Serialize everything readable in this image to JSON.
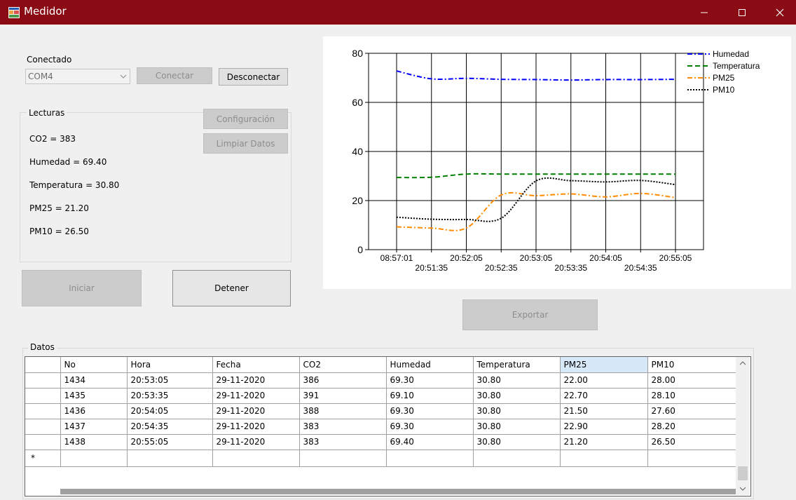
{
  "window": {
    "title": "Medidor",
    "controls": [
      "minimize",
      "maximize",
      "close"
    ]
  },
  "connection": {
    "status_label": "Conectado",
    "port_value": "COM4",
    "connect_label": "Conectar",
    "disconnect_label": "Desconectar"
  },
  "readings": {
    "group_label": "Lecturas",
    "config_label": "Configuración",
    "clear_label": "Limpiar Datos",
    "co2": "CO2 = 383",
    "humidity": "Humedad = 69.40",
    "temperature": "Temperatura = 30.80",
    "pm25": "PM25 = 21.20",
    "pm10": "PM10 = 26.50"
  },
  "actions": {
    "start_label": "Iniciar",
    "stop_label": "Detener",
    "export_label": "Exportar"
  },
  "chart_data": {
    "type": "line",
    "title": "",
    "xlabel": "",
    "ylabel": "",
    "ylim": [
      0,
      80
    ],
    "yticks": [
      0,
      20,
      40,
      60,
      80
    ],
    "grid": true,
    "legend_position": "top-right",
    "categories": [
      "08:57:01",
      "20:51:35",
      "20:52:05",
      "20:52:35",
      "20:53:05",
      "20:53:35",
      "20:54:05",
      "20:54:35",
      "20:55:05"
    ],
    "tick_rows": [
      [
        "08:57:01",
        "20:52:05",
        "20:53:05",
        "20:54:05",
        "20:55:05"
      ],
      [
        "20:51:35",
        "20:52:35",
        "20:53:35",
        "20:54:35"
      ]
    ],
    "series": [
      {
        "name": "Humedad",
        "color": "#0000ff",
        "dash": "dash-dot",
        "values": [
          72.8,
          69.6,
          69.8,
          69.4,
          69.3,
          69.1,
          69.3,
          69.3,
          69.4
        ]
      },
      {
        "name": "Temperatura",
        "color": "#008000",
        "dash": "dash",
        "values": [
          29.4,
          29.5,
          30.8,
          30.8,
          30.8,
          30.8,
          30.8,
          30.8,
          30.8
        ]
      },
      {
        "name": "PM25",
        "color": "#ff8c00",
        "dash": "dash-dot",
        "values": [
          9.3,
          8.8,
          8.8,
          22.3,
          22.0,
          22.7,
          21.5,
          22.9,
          21.2
        ]
      },
      {
        "name": "PM10",
        "color": "#000000",
        "dash": "dot",
        "values": [
          13.2,
          12.4,
          12.3,
          12.8,
          28.0,
          28.1,
          27.6,
          28.2,
          26.5
        ]
      }
    ]
  },
  "table": {
    "group_label": "Datos",
    "columns": [
      "No",
      "Hora",
      "Fecha",
      "CO2",
      "Humedad",
      "Temperatura",
      "PM25",
      "PM10"
    ],
    "rows": [
      [
        "1434",
        "20:53:05",
        "29-11-2020",
        "386",
        "69.30",
        "30.80",
        "22.00",
        "28.00"
      ],
      [
        "1435",
        "20:53:35",
        "29-11-2020",
        "391",
        "69.10",
        "30.80",
        "22.70",
        "28.10"
      ],
      [
        "1436",
        "20:54:05",
        "29-11-2020",
        "388",
        "69.30",
        "30.80",
        "21.50",
        "27.60"
      ],
      [
        "1437",
        "20:54:35",
        "29-11-2020",
        "383",
        "69.30",
        "30.80",
        "22.90",
        "28.20"
      ],
      [
        "1438",
        "20:55:05",
        "29-11-2020",
        "383",
        "69.40",
        "30.80",
        "21.20",
        "26.50"
      ]
    ],
    "new_row_marker": "*"
  }
}
